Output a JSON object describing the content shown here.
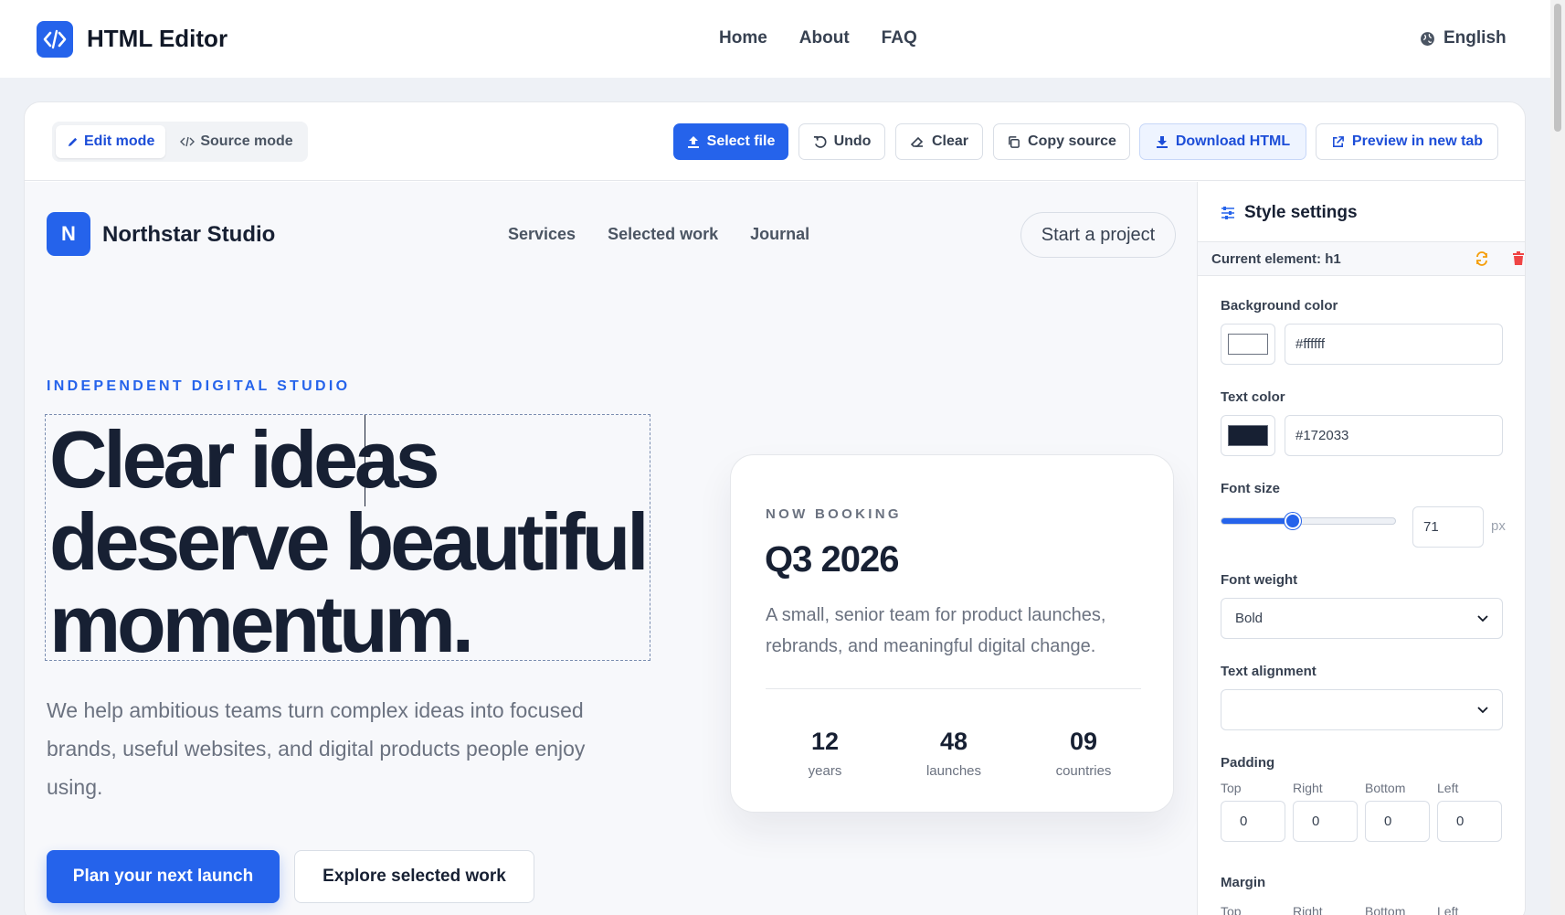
{
  "app": {
    "title": "HTML Editor",
    "nav": [
      "Home",
      "About",
      "FAQ"
    ],
    "language": "English"
  },
  "toolbar": {
    "edit_mode": "Edit mode",
    "source_mode": "Source mode",
    "select_file": "Select file",
    "undo": "Undo",
    "clear": "Clear",
    "copy_source": "Copy source",
    "download_html": "Download HTML",
    "preview_new_tab": "Preview in new tab"
  },
  "preview": {
    "logo_letter": "N",
    "site_name": "Northstar Studio",
    "nav": [
      "Services",
      "Selected work",
      "Journal"
    ],
    "cta": "Start a project",
    "eyebrow": "INDEPENDENT DIGITAL STUDIO",
    "headline_line1": "Clear ideas",
    "headline_line2": "deserve beautiful",
    "headline_line3": "momentum.",
    "paragraph": "We help ambitious teams turn complex ideas into focused brands, useful websites, and digital products people enjoy using.",
    "primary_button": "Plan your next launch",
    "secondary_button": "Explore selected work",
    "card": {
      "eyebrow": "NOW BOOKING",
      "title": "Q3 2026",
      "description": "A small, senior team for product launches, rebrands, and meaningful digital change.",
      "stats": [
        {
          "value": "12",
          "label": "years"
        },
        {
          "value": "48",
          "label": "launches"
        },
        {
          "value": "09",
          "label": "countries"
        }
      ]
    }
  },
  "sidebar": {
    "title": "Style settings",
    "current_element": "Current element: h1",
    "background_color_label": "Background color",
    "background_color_value": "#ffffff",
    "text_color_label": "Text color",
    "text_color_value": "#172033",
    "font_size_label": "Font size",
    "font_size_value": "71",
    "font_size_unit": "px",
    "font_size_slider_fraction": 0.41,
    "font_weight_label": "Font weight",
    "font_weight_value": "Bold",
    "text_alignment_label": "Text alignment",
    "text_alignment_value": "",
    "padding_label": "Padding",
    "padding": {
      "top": "0",
      "right": "0",
      "bottom": "0",
      "left": "0"
    },
    "side_labels": {
      "top": "Top",
      "right": "Right",
      "bottom": "Bottom",
      "left": "Left"
    },
    "margin_label": "Margin"
  },
  "colors": {
    "accent": "#2563eb",
    "text_dark": "#172033",
    "danger": "#ef4444",
    "sync": "#f59e0b"
  }
}
